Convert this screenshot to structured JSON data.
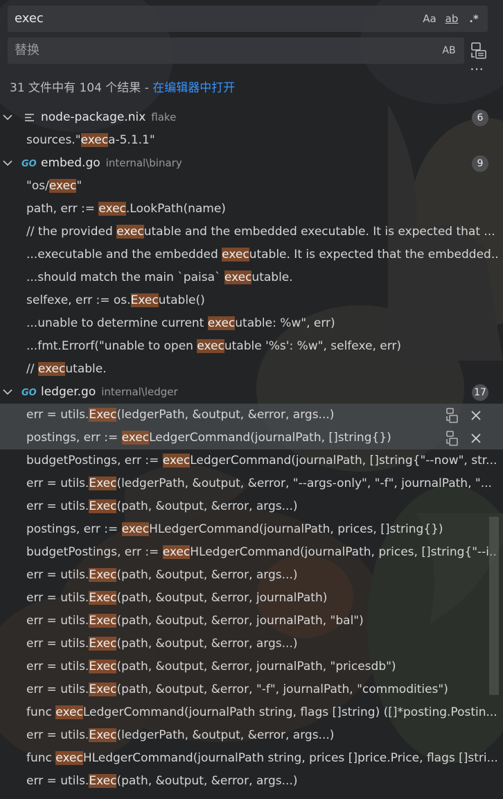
{
  "search": {
    "value": "exec",
    "option_case": "Aa",
    "option_word": "ab",
    "option_regex": ".*"
  },
  "replace": {
    "placeholder": "替换",
    "preserve_case": "AB"
  },
  "summary": {
    "text": "31 文件中有 104 个结果 - ",
    "link": "在编辑器中打开"
  },
  "files": [
    {
      "name": "node-package.nix",
      "path": "flake",
      "count": "6",
      "icon": "list-lines-icon",
      "matches": [
        [
          [
            "sources.\"",
            false
          ],
          [
            "exec",
            true
          ],
          [
            "a-5.1.1\"",
            false
          ]
        ]
      ]
    },
    {
      "name": "embed.go",
      "path": "internal\\binary",
      "count": "9",
      "icon": "go-icon",
      "matches": [
        [
          [
            "\"os/",
            false
          ],
          [
            "exec",
            true
          ],
          [
            "\"",
            false
          ]
        ],
        [
          [
            "path, err := ",
            false
          ],
          [
            "exec",
            true
          ],
          [
            ".LookPath(name)",
            false
          ]
        ],
        [
          [
            "// the provided ",
            false
          ],
          [
            "exec",
            true
          ],
          [
            "utable and the embedded executable. It is expected that ...",
            false
          ]
        ],
        [
          [
            "...executable and the embedded ",
            false
          ],
          [
            "exec",
            true
          ],
          [
            "utable. It is expected that the embedded...",
            false
          ]
        ],
        [
          [
            "...should match the main `paisa` ",
            false
          ],
          [
            "exec",
            true
          ],
          [
            "utable.",
            false
          ]
        ],
        [
          [
            "selfexe, err := os.",
            false
          ],
          [
            "Exec",
            true
          ],
          [
            "utable()",
            false
          ]
        ],
        [
          [
            "...unable to determine current ",
            false
          ],
          [
            "exec",
            true
          ],
          [
            "utable: %w\", err)",
            false
          ]
        ],
        [
          [
            "...fmt.Errorf(\"unable to open ",
            false
          ],
          [
            "exec",
            true
          ],
          [
            "utable '%s': %w\", selfexe, err)",
            false
          ]
        ],
        [
          [
            "// ",
            false
          ],
          [
            "exec",
            true
          ],
          [
            "utable.",
            false
          ]
        ]
      ]
    },
    {
      "name": "ledger.go",
      "path": "internal\\ledger",
      "count": "17",
      "icon": "go-icon",
      "matches": [
        [
          [
            "err = utils.",
            false
          ],
          [
            "Exec",
            true
          ],
          [
            "(ledgerPath, &output, &error, args...)",
            false
          ]
        ],
        [
          [
            "postings, err := ",
            false
          ],
          [
            "exec",
            true
          ],
          [
            "LedgerCommand(journalPath, []string{})",
            false
          ]
        ],
        [
          [
            "budgetPostings, err := ",
            false
          ],
          [
            "exec",
            true
          ],
          [
            "LedgerCommand(journalPath, []string{\"--now\", str...",
            false
          ]
        ],
        [
          [
            "err = utils.",
            false
          ],
          [
            "Exec",
            true
          ],
          [
            "(ledgerPath, &output, &error, \"--args-only\", \"-f\", journalPath, \"...",
            false
          ]
        ],
        [
          [
            "err = utils.",
            false
          ],
          [
            "Exec",
            true
          ],
          [
            "(path, &output, &error, args...)",
            false
          ]
        ],
        [
          [
            "postings, err := ",
            false
          ],
          [
            "exec",
            true
          ],
          [
            "HLedgerCommand(journalPath, prices, []string{})",
            false
          ]
        ],
        [
          [
            "budgetPostings, err := ",
            false
          ],
          [
            "exec",
            true
          ],
          [
            "HLedgerCommand(journalPath, prices, []string{\"--i...",
            false
          ]
        ],
        [
          [
            "err = utils.",
            false
          ],
          [
            "Exec",
            true
          ],
          [
            "(path, &output, &error, args...)",
            false
          ]
        ],
        [
          [
            "err = utils.",
            false
          ],
          [
            "Exec",
            true
          ],
          [
            "(path, &output, &error, journalPath)",
            false
          ]
        ],
        [
          [
            "err = utils.",
            false
          ],
          [
            "Exec",
            true
          ],
          [
            "(path, &output, &error, journalPath, \"bal\")",
            false
          ]
        ],
        [
          [
            "err = utils.",
            false
          ],
          [
            "Exec",
            true
          ],
          [
            "(path, &output, &error, args...)",
            false
          ]
        ],
        [
          [
            "err = utils.",
            false
          ],
          [
            "Exec",
            true
          ],
          [
            "(path, &output, &error, journalPath, \"pricesdb\")",
            false
          ]
        ],
        [
          [
            "err = utils.",
            false
          ],
          [
            "Exec",
            true
          ],
          [
            "(path, &output, &error, \"-f\", journalPath, \"commodities\")",
            false
          ]
        ],
        [
          [
            "func ",
            false
          ],
          [
            "exec",
            true
          ],
          [
            "LedgerCommand(journalPath string, flags []string) ([]*posting.Postin...",
            false
          ]
        ],
        [
          [
            "err = utils.",
            false
          ],
          [
            "Exec",
            true
          ],
          [
            "(ledgerPath, &output, &error, args...)",
            false
          ]
        ],
        [
          [
            "func ",
            false
          ],
          [
            "exec",
            true
          ],
          [
            "HLedgerCommand(journalPath string, prices []price.Price, flags []stri...",
            false
          ]
        ],
        [
          [
            "err = utils.",
            false
          ],
          [
            "Exec",
            true
          ],
          [
            "(path, &output, &error, args...)",
            false
          ]
        ]
      ]
    }
  ],
  "colors": {
    "background": "#232426",
    "highlight": "#9b552d",
    "link": "#3794ff",
    "badge": "#4d4f53"
  }
}
